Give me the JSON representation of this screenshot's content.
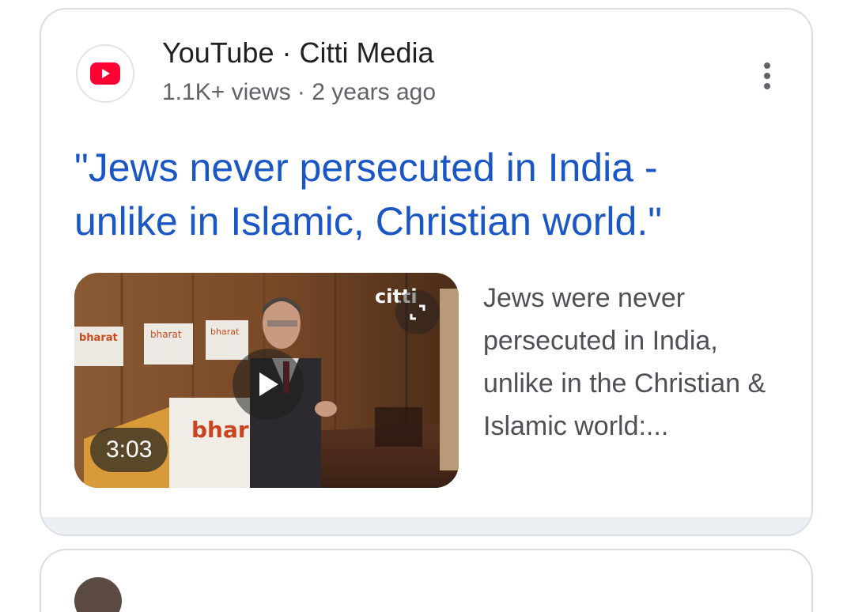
{
  "result": {
    "source": "YouTube · Citti Media",
    "meta": "1.1K+ views · 2 years ago",
    "title": "\"Jews never persecuted in India - unlike in Islamic, Christian world.\"",
    "snippet": "Jews were never persecuted in India, unlike in the Christian & Islamic world:...",
    "duration": "3:03",
    "thumbnail": {
      "channel_watermark": "citti",
      "banner_text": "bharat"
    },
    "icons": {
      "logo": "youtube-logo-icon",
      "menu": "more-vert-icon",
      "play": "play-icon",
      "expand": "expand-icon"
    },
    "colors": {
      "title": "#1a56c6",
      "youtube_red": "#ff0033",
      "meta": "#5f6368",
      "snippet": "#4d5156"
    }
  }
}
